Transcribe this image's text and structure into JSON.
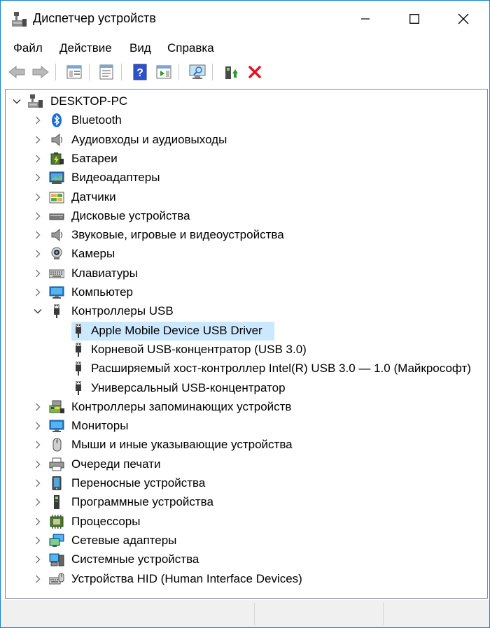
{
  "window": {
    "title": "Диспетчер устройств"
  },
  "menu": [
    "Файл",
    "Действие",
    "Вид",
    "Справка"
  ],
  "tree": {
    "root": "DESKTOP-PC",
    "categories": [
      {
        "label": "Bluetooth",
        "icon": "bluetooth-icon"
      },
      {
        "label": "Аудиовходы и аудиовыходы",
        "icon": "speaker-icon"
      },
      {
        "label": "Батареи",
        "icon": "battery-icon"
      },
      {
        "label": "Видеоадаптеры",
        "icon": "display-adapter-icon"
      },
      {
        "label": "Датчики",
        "icon": "sensor-icon"
      },
      {
        "label": "Дисковые устройства",
        "icon": "disk-drive-icon"
      },
      {
        "label": "Звуковые, игровые и видеоустройства",
        "icon": "speaker-icon"
      },
      {
        "label": "Камеры",
        "icon": "webcam-icon"
      },
      {
        "label": "Клавиатуры",
        "icon": "keyboard-icon"
      },
      {
        "label": "Компьютер",
        "icon": "monitor-icon"
      },
      {
        "label": "Контроллеры USB",
        "icon": "usb-icon",
        "expanded": true,
        "children": [
          {
            "label": "Apple Mobile Device USB Driver",
            "selected": true
          },
          {
            "label": "Корневой USB-концентратор (USB 3.0)"
          },
          {
            "label": "Расширяемый хост-контроллер Intel(R) USB 3.0 — 1.0 (Майкрософт)"
          },
          {
            "label": "Универсальный USB-концентратор"
          }
        ]
      },
      {
        "label": "Контроллеры запоминающих устройств",
        "icon": "storage-controller-icon"
      },
      {
        "label": "Мониторы",
        "icon": "monitor-icon"
      },
      {
        "label": "Мыши и иные указывающие устройства",
        "icon": "mouse-icon"
      },
      {
        "label": "Очереди печати",
        "icon": "printer-icon"
      },
      {
        "label": "Переносные устройства",
        "icon": "portable-device-icon"
      },
      {
        "label": "Программные устройства",
        "icon": "software-device-icon"
      },
      {
        "label": "Процессоры",
        "icon": "processor-icon"
      },
      {
        "label": "Сетевые адаптеры",
        "icon": "network-adapter-icon"
      },
      {
        "label": "Системные устройства",
        "icon": "system-device-icon"
      },
      {
        "label": "Устройства HID (Human Interface Devices)",
        "icon": "hid-icon"
      }
    ]
  },
  "colors": {
    "selection": "#cce8ff",
    "window_border": "#1883d7",
    "delete": "#e81123",
    "help": "#3052c8"
  }
}
